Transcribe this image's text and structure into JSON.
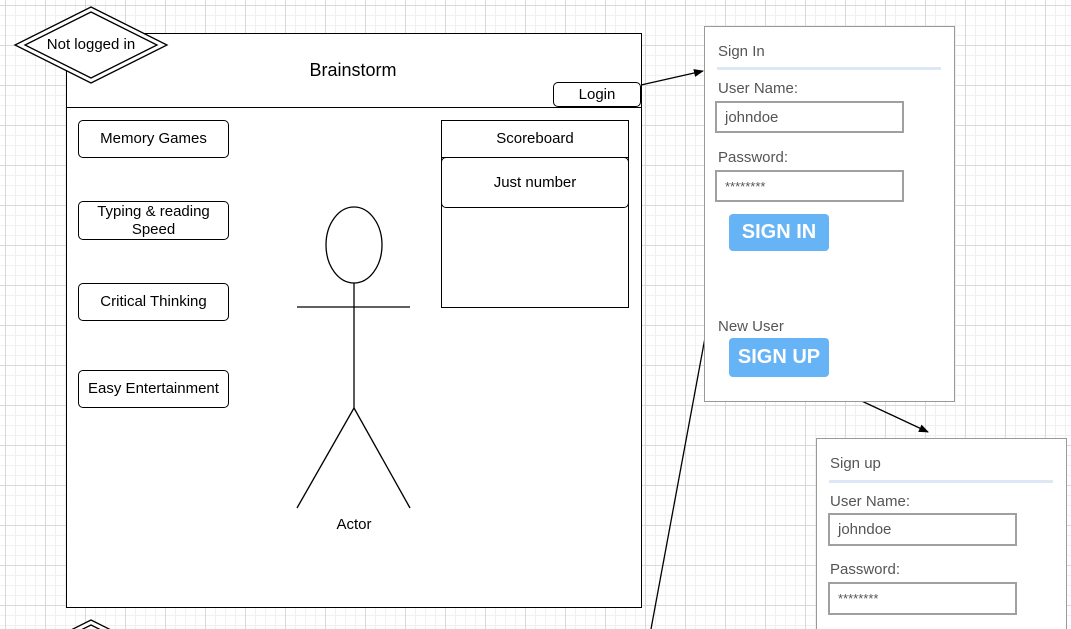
{
  "main_screen": {
    "status": "Not logged in",
    "title": "Brainstorm",
    "login_label": "Login",
    "menu_items": [
      {
        "label": "Memory Games"
      },
      {
        "label": "Typing & reading Speed"
      },
      {
        "label": "Critical Thinking"
      },
      {
        "label": "Easy Entertainment"
      }
    ],
    "scoreboard": {
      "title": "Scoreboard",
      "entry": "Just number"
    },
    "actor_label": "Actor"
  },
  "sign_in_form": {
    "title": "Sign In",
    "username_label": "User Name:",
    "username_value": "johndoe",
    "password_label": "Password:",
    "password_value": "********",
    "submit_label": "SIGN IN",
    "new_user_label": "New User",
    "signup_label": "SIGN UP"
  },
  "sign_up_form": {
    "title": "Sign up",
    "username_label": "User Name:",
    "username_value": "johndoe",
    "password_label": "Password:",
    "password_value": "********"
  },
  "colors": {
    "button_blue": "#66b3f5",
    "title_underline": "#dde8f5",
    "form_border": "#999999"
  }
}
